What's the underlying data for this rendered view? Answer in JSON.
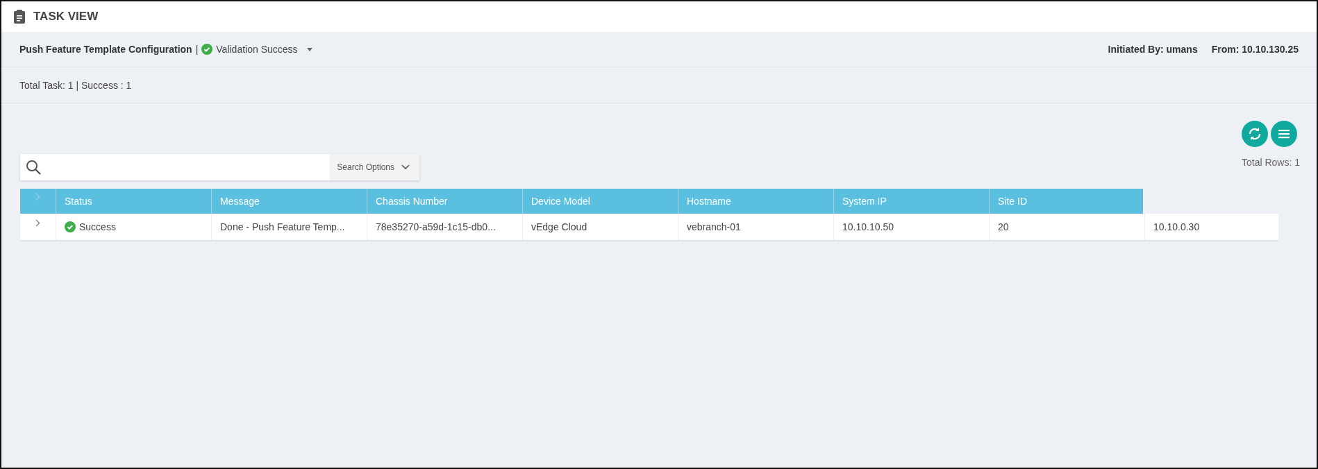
{
  "header": {
    "title": "TASK VIEW"
  },
  "task_bar": {
    "name": "Push Feature Template Configuration",
    "separator": "|",
    "status": "Validation Success",
    "initiated_by": "Initiated By: umans",
    "from": "From: 10.10.130.25"
  },
  "summary": "Total Task: 1 | Success : 1",
  "toolbar": {
    "total_rows": "Total Rows: 1"
  },
  "search": {
    "options_label": "Search Options"
  },
  "table": {
    "columns": [
      "Status",
      "Message",
      "Chassis Number",
      "Device Model",
      "Hostname",
      "System IP",
      "Site ID"
    ],
    "rows": [
      {
        "expanded": false,
        "cells": [
          "Success",
          "Done - Push Feature Temp...",
          "78e35270-a59d-1c15-db0...",
          "vEdge Cloud",
          "vebranch-01",
          "10.10.10.50",
          "20",
          "10.10.0.30"
        ]
      }
    ]
  }
}
